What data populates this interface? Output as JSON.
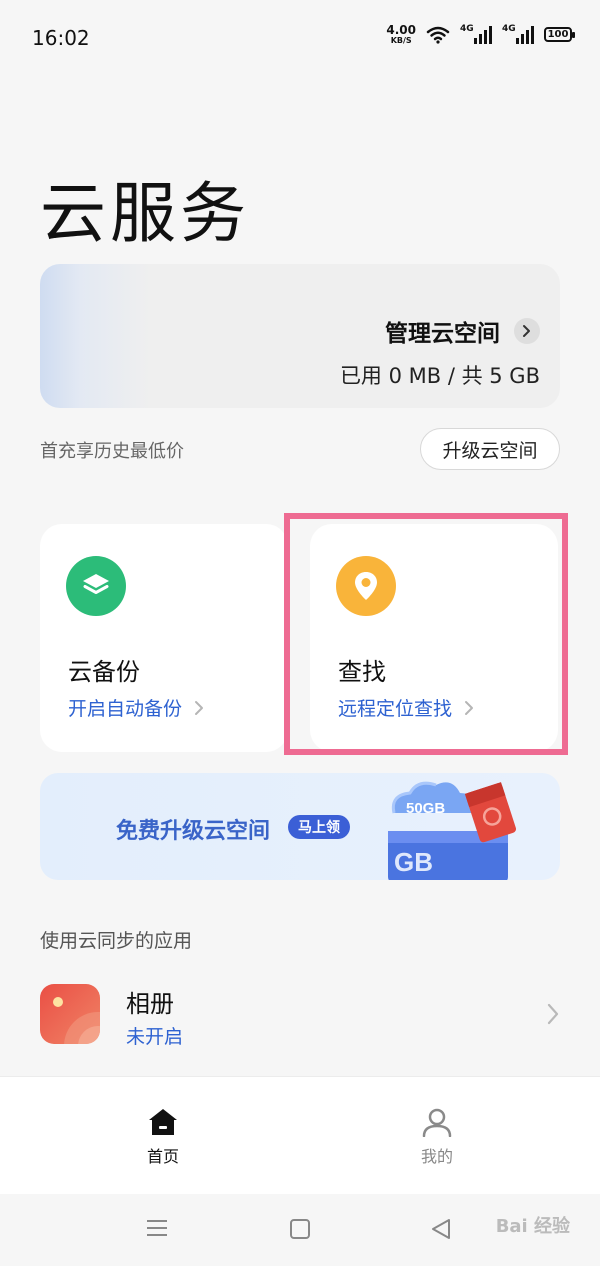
{
  "status_bar": {
    "time": "16:02",
    "net_speed_value": "4.00",
    "net_speed_unit": "KB/S",
    "signal1_label": "4G",
    "signal2_label": "4G",
    "battery": "100"
  },
  "page": {
    "title": "云服务"
  },
  "storage": {
    "manage_label": "管理云空间",
    "usage": "已用 0 MB / 共 5 GB"
  },
  "promo": {
    "text": "首充享历史最低价",
    "upgrade_label": "升级云空间"
  },
  "features": [
    {
      "title": "云备份",
      "link": "开启自动备份",
      "icon": "layers-icon",
      "color": "#2cbc79"
    },
    {
      "title": "查找",
      "link": "远程定位查找",
      "icon": "location-pin-icon",
      "color": "#f9b43a"
    }
  ],
  "banner": {
    "text": "免费升级云空间",
    "tag": "马上领",
    "cloud_text": "50GB",
    "gb_text": "GB"
  },
  "apps_section": {
    "label": "使用云同步的应用",
    "items": [
      {
        "name": "相册",
        "status": "未开启"
      }
    ]
  },
  "bottom_nav": {
    "items": [
      {
        "label": "首页",
        "active": true
      },
      {
        "label": "我的",
        "active": false
      }
    ]
  },
  "watermark": "Bai 经验",
  "colors": {
    "accent": "#2e62d1",
    "highlight": "#ee6b92"
  }
}
